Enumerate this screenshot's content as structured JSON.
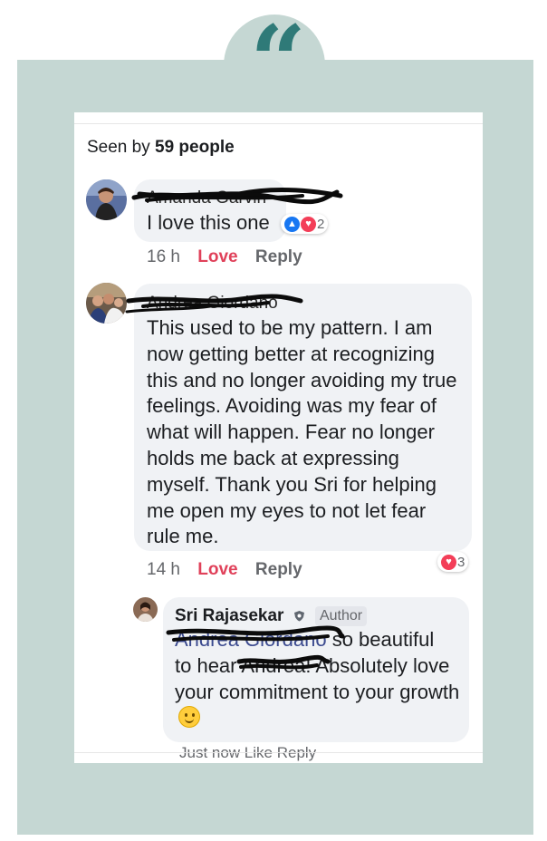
{
  "seen": {
    "prefix": "Seen by",
    "count": "59 people"
  },
  "comments": [
    {
      "name": "Amanda Garvin",
      "text": "I love this one",
      "time": "16 h",
      "love_label": "Love",
      "reply_label": "Reply",
      "reactions": {
        "icons": [
          "like-icon",
          "heart-icon"
        ],
        "count": "2"
      }
    },
    {
      "name": "Andrea Giordano",
      "text": "This used to be my pattern. I am now getting better at recognizing this and no longer avoiding my true feelings. Avoiding was my fear of what will happen. Fear no longer holds me back at expressing myself. Thank you Sri for helping me open my eyes to not let fear rule me.",
      "time": "14 h",
      "love_label": "Love",
      "reply_label": "Reply",
      "reactions": {
        "icons": [
          "heart-icon"
        ],
        "count": "3"
      }
    }
  ],
  "reply": {
    "name": "Sri Rajasekar",
    "badge": "Author",
    "tag": "Andrea Giordano",
    "text_a": "so beautiful",
    "text_b": "to hear",
    "tag2": "Andrea",
    "text_c": "! Absolutely love your commitment to your growth",
    "emoji": "slightly-smiling-face-icon",
    "meta": "Just now   Like   Reply"
  },
  "colors": {
    "frame": "#c5d7d3",
    "quote": "#2f7a78",
    "love": "#e0415a",
    "bubble": "#f0f2f5"
  },
  "quote_mark": "“"
}
